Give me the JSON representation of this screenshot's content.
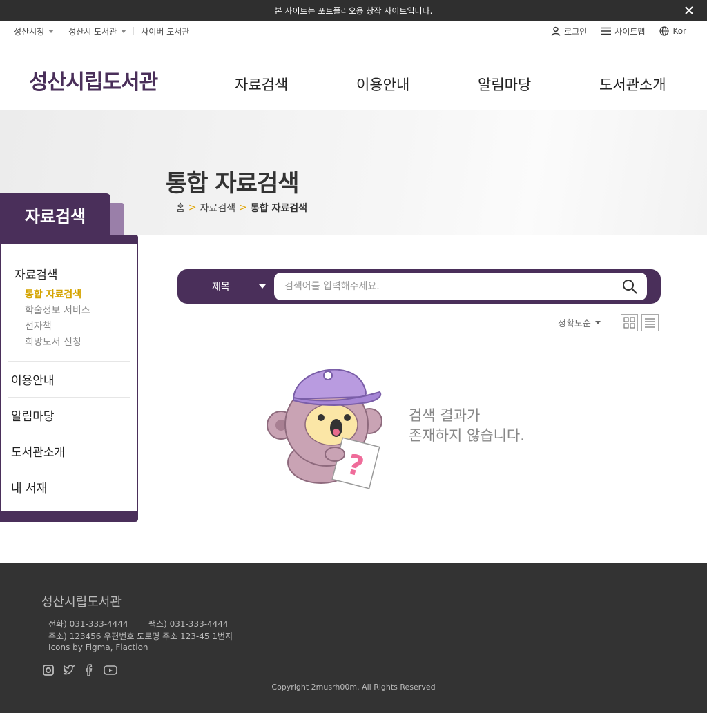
{
  "notice": {
    "text": "본 사이트는 포트폴리오용 창작 사이트입니다."
  },
  "util": {
    "left": [
      "성산시청",
      "성산시 도서관",
      "사이버 도서관"
    ],
    "login": "로그인",
    "sitemap": "사이트맵",
    "lang": "Kor"
  },
  "header": {
    "logo": "성산시립도서관",
    "nav": [
      "자료검색",
      "이용안내",
      "알림마당",
      "도서관소개"
    ]
  },
  "hero": {
    "title": "통합 자료검색",
    "breadcrumb": [
      "홈",
      "자료검색",
      "통합 자료검색"
    ],
    "separator": ">"
  },
  "sidebar": {
    "tab": "자료검색",
    "section": "자료검색",
    "sub": [
      "통합 자료검색",
      "학술정보 서비스",
      "전자책",
      "희망도서 신청"
    ],
    "menus": [
      "이용안내",
      "알림마당",
      "도서관소개",
      "내 서재"
    ]
  },
  "search": {
    "select_label": "제목",
    "placeholder": "검색어를 입력해주세요.",
    "value": ""
  },
  "sort": {
    "label": "정확도순"
  },
  "empty": {
    "line1": "검색 결과가",
    "line2": "존재하지 않습니다."
  },
  "footer": {
    "logo": "성산시립도서관",
    "phone": "전화) 031-333-4444",
    "fax": "팩스) 031-333-4444",
    "address": "주소) 123456 우편번호 도로명 주소 123-45 1번지",
    "credits": "Icons by Figma, Flaction",
    "copyright": "Copyright 2musrh00m. All Rights Reserved"
  },
  "colors": {
    "brand": "#4a2f5a",
    "brand_light": "#9a7fa9",
    "accent": "#d4a400",
    "footer": "#333333"
  },
  "icons": [
    "close-icon",
    "user-icon",
    "menu-icon",
    "globe-icon",
    "search-icon",
    "grid-view-icon",
    "list-view-icon",
    "instagram-icon",
    "twitter-icon",
    "facebook-icon",
    "youtube-icon"
  ]
}
